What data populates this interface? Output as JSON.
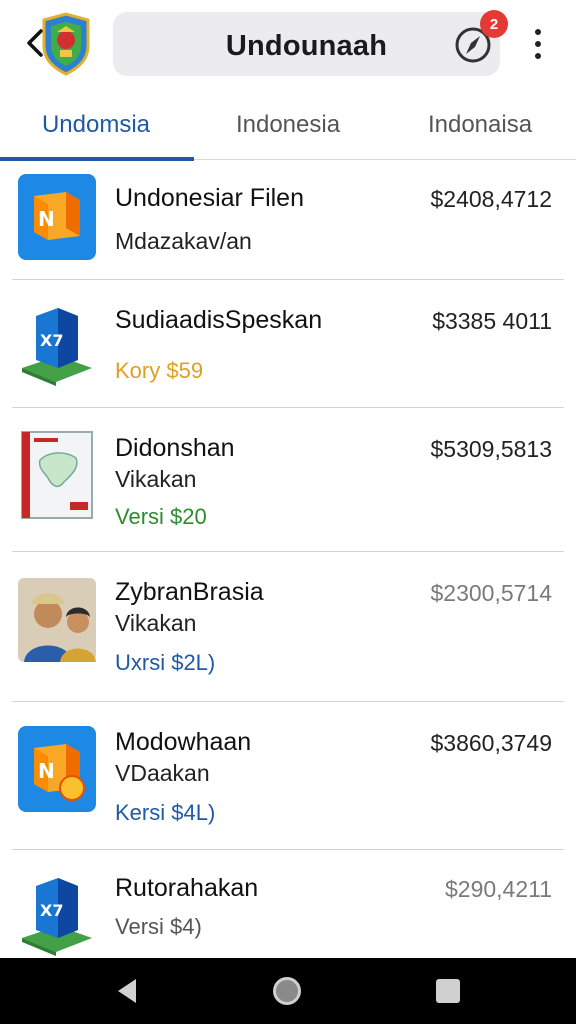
{
  "header": {
    "title": "Undounaah",
    "notification_count": "2",
    "icons": [
      "back-arrow-icon",
      "shield-logo-icon",
      "compass-icon",
      "more-vert-icon"
    ]
  },
  "tabs": [
    {
      "label": "Undomsia",
      "active": true
    },
    {
      "label": "Indonesia",
      "active": false
    },
    {
      "label": "Indonaisa",
      "active": false
    }
  ],
  "items": [
    {
      "name": "Undonesiar Filen",
      "price": "$2408,4712",
      "subtitle": "Mdazakav/an",
      "version": "",
      "version_color": "",
      "icon": "orange-folder-app-icon"
    },
    {
      "name": "SudiaadisSpeskan",
      "price": "$3385 4011",
      "subtitle": "",
      "version": "Kory $59",
      "version_color": "#e0a020",
      "icon": "blue-cube-app-icon"
    },
    {
      "name": "Didonshan",
      "price": "$5309,5813",
      "subtitle": "Vikakan",
      "version": "Versi $20",
      "version_color": "#2e8b2e",
      "icon": "map-box-icon"
    },
    {
      "name": "ZybranBrasia",
      "price": "$2300,5714",
      "subtitle": "Vikakan",
      "version": "Uxrsi $2L)",
      "version_color": "#1f5aa6",
      "icon": "people-photo-icon"
    },
    {
      "name": "Modowhaan",
      "price": "$3860,3749",
      "subtitle": "VDaakan",
      "version": "Kersi $4L)",
      "version_color": "#1f5aa6",
      "icon": "orange-folder-coin-icon"
    },
    {
      "name": "Rutorahakan",
      "price": "$290,4211",
      "subtitle": "",
      "version": "Versi $4)",
      "version_color": "#555555",
      "icon": "blue-cube-app-icon"
    }
  ],
  "navbar": {
    "icons": [
      "nav-back-icon",
      "nav-home-icon",
      "nav-recents-icon"
    ]
  },
  "colors": {
    "accent": "#1f5aa6",
    "badge": "#e53935",
    "title_box": "#ececee"
  }
}
